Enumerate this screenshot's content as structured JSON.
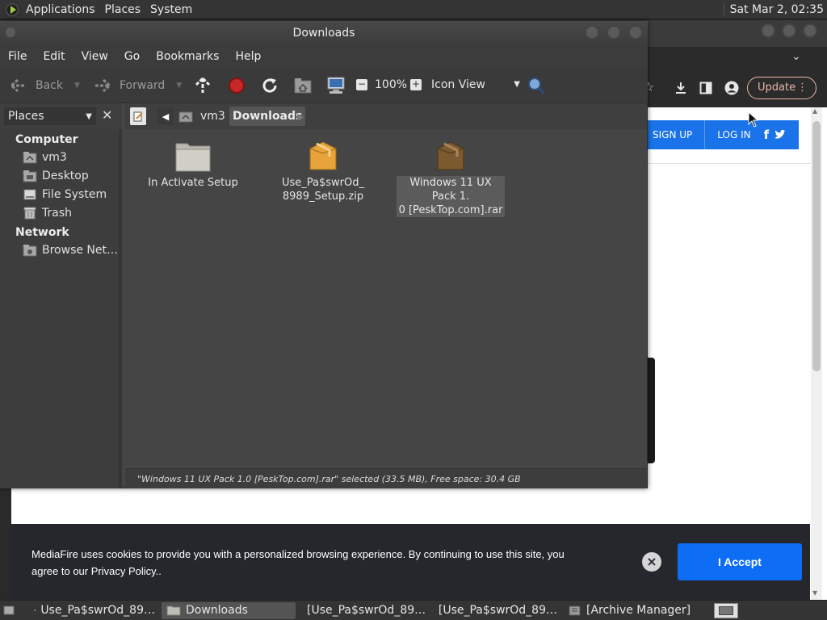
{
  "top_panel": {
    "menus": [
      "Applications",
      "Places",
      "System"
    ],
    "clock": "Sat Mar  2, 02:35"
  },
  "browser": {
    "update_label": "Update",
    "signup_label": "SIGN UP",
    "login_label": "LOG IN",
    "cookie_text": "MediaFire uses cookies to provide you with a personalized browsing experience. By continuing to use this site, you agree to our Privacy Policy..",
    "accept_label": "I Accept"
  },
  "file_manager": {
    "title": "Downloads",
    "menubar": [
      "File",
      "Edit",
      "View",
      "Go",
      "Bookmarks",
      "Help"
    ],
    "toolbar": {
      "back_label": "Back",
      "forward_label": "Forward",
      "zoom": "100%",
      "view_mode": "Icon View"
    },
    "sidebar": {
      "header": "Places",
      "categories": [
        {
          "label": "Computer",
          "items": [
            {
              "label": "vm3",
              "icon": "home-folder-icon"
            },
            {
              "label": "Desktop",
              "icon": "desktop-folder-icon"
            },
            {
              "label": "File System",
              "icon": "drive-icon"
            },
            {
              "label": "Trash",
              "icon": "trash-icon"
            }
          ]
        },
        {
          "label": "Network",
          "items": [
            {
              "label": "Browse Net…",
              "icon": "network-icon"
            }
          ]
        }
      ]
    },
    "path": [
      "vm3",
      "Downloads"
    ],
    "files": [
      {
        "name_line1": "In Activate Setup",
        "name_line2": "",
        "icon": "folder-icon",
        "selected": false
      },
      {
        "name_line1": "Use_Pa$swrOd_",
        "name_line2": "8989_Setup.zip",
        "icon": "zip-archive-icon",
        "selected": false
      },
      {
        "name_line1": "Windows 11 UX Pack 1.",
        "name_line2": "0  [PeskTop.com].rar",
        "icon": "rar-archive-icon",
        "selected": true
      }
    ],
    "status": "\"Windows 11 UX Pack 1.0  [PeskTop.com].rar\" selected (33.5 MB), Free space: 30.4 GB"
  },
  "taskbar": {
    "tasks": [
      {
        "label": "Use_Pa$swrOd_89…",
        "icon": "chrome-icon",
        "active": false
      },
      {
        "label": "Downloads",
        "icon": "folder-icon",
        "active": true
      },
      {
        "label": "[Use_Pa$swrOd_89…",
        "icon": "archive-manager-icon",
        "active": false
      },
      {
        "label": "[Use_Pa$swrOd_89…",
        "icon": "archive-manager-icon",
        "active": false
      },
      {
        "label": "[Archive Manager]",
        "icon": "archive-manager-icon",
        "active": false
      }
    ]
  },
  "colors": {
    "accent_blue": "#0d6ef5",
    "panel_bg": "#353535",
    "window_bg": "#454545"
  }
}
